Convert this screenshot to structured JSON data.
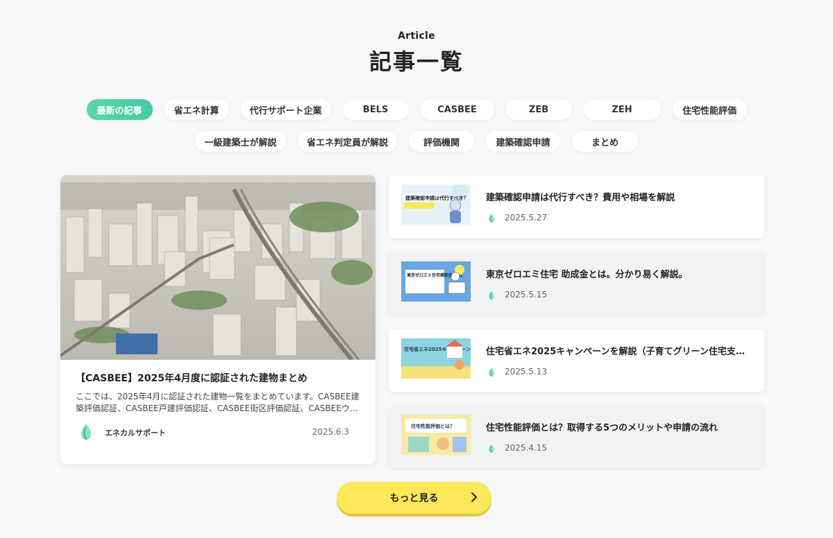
{
  "header": {
    "eyebrow": "Article",
    "title": "記事一覧"
  },
  "tabs_row1": [
    "最新の記事",
    "省エネ計算",
    "代行サポート企業",
    "BELS",
    "CASBEE",
    "ZEB",
    "ZEH",
    "住宅性能評価"
  ],
  "tabs_row2": [
    "一級建築士が解説",
    "省エネ判定員が解説",
    "評価機関",
    "建築確認申請",
    "まとめ"
  ],
  "featured": {
    "title": "【CASBEE】2025年4月度に認証された建物まとめ",
    "excerpt": "ここでは、2025年4月に認証された建物一覧をまとめています。CASBEE建築評価認証、CASBEE戸建評価認証、CASBEE街区評価認証、CASBEEウェルネスオフィス評価認証など",
    "author": "エネカルサポート",
    "date": "2025.6.3"
  },
  "articles": [
    {
      "title": "建築確認申請は代行すべき？費用や相場を解説",
      "date": "2025.5.27",
      "thumb_text": "建築確認申請は代行すべき？"
    },
    {
      "title": "東京ゼロエミ住宅 助成金とは。分かり易く解説。",
      "date": "2025.5.15",
      "thumb_text": "東京ゼロエミ住宅補助金とは。"
    },
    {
      "title": "住宅省エネ2025キャンペーンを解説（子育てグリーン住宅支援事業）",
      "date": "2025.5.13",
      "thumb_text": "住宅省エネ2025キャンペーン"
    },
    {
      "title": "住宅性能評価とは？取得する5つのメリットや申請の流れ",
      "date": "2025.4.15",
      "thumb_text": "住宅性能評価とは？"
    }
  ],
  "more_button": {
    "label": "もっと見る"
  },
  "colors": {
    "accent_green": "#4fd0a6",
    "button_yellow": "#fde85a",
    "background": "#f6f7f9"
  },
  "icons": {
    "brand_logo": "drop-leaf-icon",
    "more_chevron": "chevron-right-icon"
  }
}
